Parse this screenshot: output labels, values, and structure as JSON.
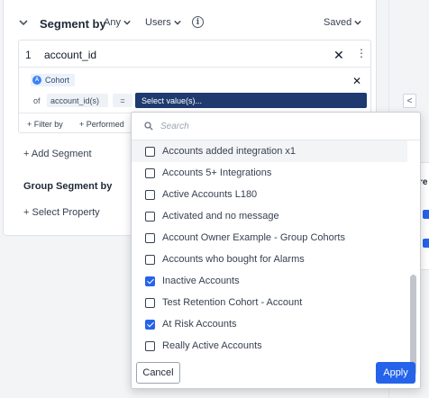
{
  "segment": {
    "title": "Segment by",
    "any_label": "Any",
    "users_label": "Users",
    "info_glyph": "i",
    "saved_label": "Saved",
    "card": {
      "index": "1",
      "property": "account_id",
      "cohort_label": "Cohort",
      "of_label": "of",
      "property_chip": "account_id(s)",
      "operator": "=",
      "value_placeholder": "Select value(s)...",
      "filter_by": "+ Filter by",
      "performed": "+ Performed"
    },
    "add_segment": "+ Add Segment",
    "group_title": "Group Segment by",
    "select_property": "+ Select Property"
  },
  "dropdown": {
    "search_placeholder": "Search",
    "options": [
      {
        "label": "Accounts added integration x1",
        "checked": false
      },
      {
        "label": "Accounts 5+ Integrations",
        "checked": false
      },
      {
        "label": "Active Accounts L180",
        "checked": false
      },
      {
        "label": "Activated and no message",
        "checked": false
      },
      {
        "label": "Account Owner Example - Group Cohorts",
        "checked": false
      },
      {
        "label": "Accounts who bought for Alarms",
        "checked": false
      },
      {
        "label": "Inactive Accounts",
        "checked": true
      },
      {
        "label": "Test Retention Cohort - Account",
        "checked": false
      },
      {
        "label": "At Risk Accounts",
        "checked": true
      },
      {
        "label": "Really Active Accounts",
        "checked": false
      }
    ],
    "cancel_label": "Cancel",
    "apply_label": "Apply"
  },
  "right_panel": {
    "text_fragment": "re",
    "collapse_glyph": "<"
  },
  "colors": {
    "accent": "#2563eb",
    "value_select_bg": "#1e3a6e"
  }
}
